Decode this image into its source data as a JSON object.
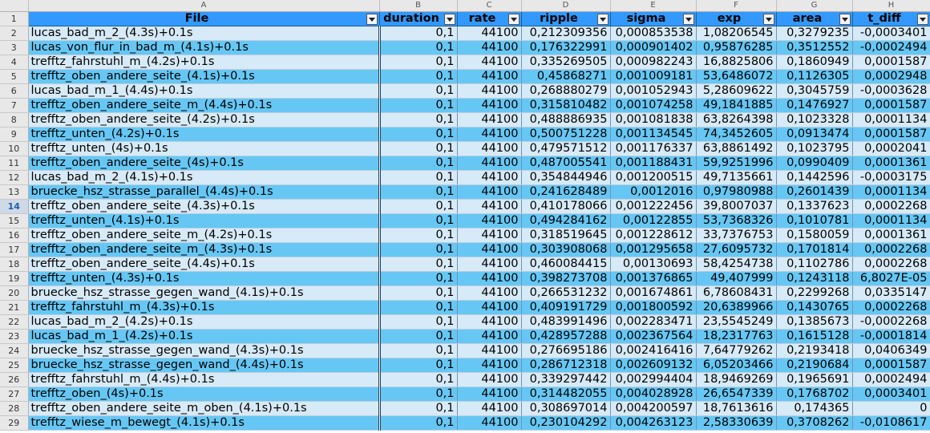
{
  "column_letters": [
    "A",
    "B",
    "C",
    "D",
    "E",
    "F",
    "G",
    "H"
  ],
  "headers": [
    "File",
    "duration",
    "rate",
    "ripple",
    "sigma",
    "exp",
    "area",
    "t_diff"
  ],
  "selected_row": "14",
  "rows": [
    {
      "n": "2",
      "file": "lucas_bad_m_2_(4.3s)+0.1s",
      "duration": "0,1",
      "rate": "44100",
      "ripple": "0,212309356",
      "sigma": "0,000853538",
      "exp": "1,08206545",
      "area": "0,3279235",
      "t_diff": "-0,0003401"
    },
    {
      "n": "3",
      "file": "lucas_von_flur_in_bad_m_(4.1s)+0.1s",
      "duration": "0,1",
      "rate": "44100",
      "ripple": "0,176322991",
      "sigma": "0,000901402",
      "exp": "0,95876285",
      "area": "0,3512552",
      "t_diff": "-0,0002494"
    },
    {
      "n": "4",
      "file": "trefftz_fahrstuhl_m_(4.2s)+0.1s",
      "duration": "0,1",
      "rate": "44100",
      "ripple": "0,335269505",
      "sigma": "0,000982243",
      "exp": "16,8825806",
      "area": "0,1860949",
      "t_diff": "0,0001587"
    },
    {
      "n": "5",
      "file": "trefftz_oben_andere_seite_(4.1s)+0.1s",
      "duration": "0,1",
      "rate": "44100",
      "ripple": "0,45868271",
      "sigma": "0,001009181",
      "exp": "53,6486072",
      "area": "0,1126305",
      "t_diff": "0,0002948"
    },
    {
      "n": "6",
      "file": "lucas_bad_m_1_(4.4s)+0.1s",
      "duration": "0,1",
      "rate": "44100",
      "ripple": "0,268880279",
      "sigma": "0,001052943",
      "exp": "5,28609622",
      "area": "0,3045759",
      "t_diff": "-0,0003628"
    },
    {
      "n": "7",
      "file": "trefftz_oben_andere_seite_m_(4.4s)+0.1s",
      "duration": "0,1",
      "rate": "44100",
      "ripple": "0,315810482",
      "sigma": "0,001074258",
      "exp": "49,1841885",
      "area": "0,1476927",
      "t_diff": "0,0001587"
    },
    {
      "n": "8",
      "file": "trefftz_oben_andere_seite_(4.2s)+0.1s",
      "duration": "0,1",
      "rate": "44100",
      "ripple": "0,488886935",
      "sigma": "0,001081838",
      "exp": "63,8264398",
      "area": "0,1023328",
      "t_diff": "0,0001134"
    },
    {
      "n": "9",
      "file": "trefftz_unten_(4.2s)+0.1s",
      "duration": "0,1",
      "rate": "44100",
      "ripple": "0,500751228",
      "sigma": "0,001134545",
      "exp": "74,3452605",
      "area": "0,0913474",
      "t_diff": "0,0001587"
    },
    {
      "n": "10",
      "file": "trefftz_unten_(4s)+0.1s",
      "duration": "0,1",
      "rate": "44100",
      "ripple": "0,479571512",
      "sigma": "0,001176337",
      "exp": "63,8861492",
      "area": "0,1023795",
      "t_diff": "0,0002041"
    },
    {
      "n": "11",
      "file": "trefftz_oben_andere_seite_(4s)+0.1s",
      "duration": "0,1",
      "rate": "44100",
      "ripple": "0,487005541",
      "sigma": "0,001188431",
      "exp": "59,9251996",
      "area": "0,0990409",
      "t_diff": "0,0001361"
    },
    {
      "n": "12",
      "file": "lucas_bad_m_2_(4.1s)+0.1s",
      "duration": "0,1",
      "rate": "44100",
      "ripple": "0,354844946",
      "sigma": "0,001200515",
      "exp": "49,7135661",
      "area": "0,1442596",
      "t_diff": "-0,0003175"
    },
    {
      "n": "13",
      "file": "bruecke_hsz_strasse_parallel_(4.4s)+0.1s",
      "duration": "0,1",
      "rate": "44100",
      "ripple": "0,241628489",
      "sigma": "0,0012016",
      "exp": "0,97980988",
      "area": "0,2601439",
      "t_diff": "0,0001134"
    },
    {
      "n": "14",
      "file": "trefftz_oben_andere_seite_(4.3s)+0.1s",
      "duration": "0,1",
      "rate": "44100",
      "ripple": "0,410178066",
      "sigma": "0,001222456",
      "exp": "39,8007037",
      "area": "0,1337623",
      "t_diff": "0,0002268"
    },
    {
      "n": "15",
      "file": "trefftz_unten_(4.1s)+0.1s",
      "duration": "0,1",
      "rate": "44100",
      "ripple": "0,494284162",
      "sigma": "0,00122855",
      "exp": "53,7368326",
      "area": "0,1010781",
      "t_diff": "0,0001134"
    },
    {
      "n": "16",
      "file": "trefftz_oben_andere_seite_m_(4.2s)+0.1s",
      "duration": "0,1",
      "rate": "44100",
      "ripple": "0,318519645",
      "sigma": "0,001228612",
      "exp": "33,7376753",
      "area": "0,1580059",
      "t_diff": "0,0001361"
    },
    {
      "n": "17",
      "file": "trefftz_oben_andere_seite_m_(4.3s)+0.1s",
      "duration": "0,1",
      "rate": "44100",
      "ripple": "0,303908068",
      "sigma": "0,001295658",
      "exp": "27,6095732",
      "area": "0,1701814",
      "t_diff": "0,0002268"
    },
    {
      "n": "18",
      "file": "trefftz_oben_andere_seite_(4.4s)+0.1s",
      "duration": "0,1",
      "rate": "44100",
      "ripple": "0,460084415",
      "sigma": "0,00130693",
      "exp": "58,4254738",
      "area": "0,1102786",
      "t_diff": "0,0002268"
    },
    {
      "n": "19",
      "file": "trefftz_unten_(4.3s)+0.1s",
      "duration": "0,1",
      "rate": "44100",
      "ripple": "0,398273708",
      "sigma": "0,001376865",
      "exp": "49,407999",
      "area": "0,1243118",
      "t_diff": "6,8027E-05"
    },
    {
      "n": "20",
      "file": "bruecke_hsz_strasse_gegen_wand_(4.1s)+0.1s",
      "duration": "0,1",
      "rate": "44100",
      "ripple": "0,266531232",
      "sigma": "0,001674861",
      "exp": "6,78608431",
      "area": "0,2299268",
      "t_diff": "0,0335147"
    },
    {
      "n": "21",
      "file": "trefftz_fahrstuhl_m_(4.3s)+0.1s",
      "duration": "0,1",
      "rate": "44100",
      "ripple": "0,409191729",
      "sigma": "0,001800592",
      "exp": "20,6389966",
      "area": "0,1430765",
      "t_diff": "0,0002268"
    },
    {
      "n": "22",
      "file": "lucas_bad_m_2_(4.2s)+0.1s",
      "duration": "0,1",
      "rate": "44100",
      "ripple": "0,483991496",
      "sigma": "0,002283471",
      "exp": "23,5545249",
      "area": "0,1385673",
      "t_diff": "-0,0002268"
    },
    {
      "n": "23",
      "file": "lucas_bad_m_1_(4.2s)+0.1s",
      "duration": "0,1",
      "rate": "44100",
      "ripple": "0,428957288",
      "sigma": "0,002367564",
      "exp": "18,2317763",
      "area": "0,1615128",
      "t_diff": "-0,0001814"
    },
    {
      "n": "24",
      "file": "bruecke_hsz_strasse_gegen_wand_(4.3s)+0.1s",
      "duration": "0,1",
      "rate": "44100",
      "ripple": "0,276695186",
      "sigma": "0,002416416",
      "exp": "7,64779262",
      "area": "0,2193418",
      "t_diff": "0,0406349"
    },
    {
      "n": "25",
      "file": "bruecke_hsz_strasse_gegen_wand_(4.4s)+0.1s",
      "duration": "0,1",
      "rate": "44100",
      "ripple": "0,286712318",
      "sigma": "0,002609132",
      "exp": "6,05203466",
      "area": "0,2190684",
      "t_diff": "0,0001587"
    },
    {
      "n": "26",
      "file": "trefftz_fahrstuhl_m_(4.4s)+0.1s",
      "duration": "0,1",
      "rate": "44100",
      "ripple": "0,339297442",
      "sigma": "0,002994404",
      "exp": "18,9469269",
      "area": "0,1965691",
      "t_diff": "0,0002494"
    },
    {
      "n": "27",
      "file": "trefftz_oben_(4s)+0.1s",
      "duration": "0,1",
      "rate": "44100",
      "ripple": "0,314482055",
      "sigma": "0,004028928",
      "exp": "26,6547339",
      "area": "0,1768702",
      "t_diff": "0,0003401"
    },
    {
      "n": "28",
      "file": "trefftz_oben_andere_seite_m_oben_(4.1s)+0.1s",
      "duration": "0,1",
      "rate": "44100",
      "ripple": "0,308697014",
      "sigma": "0,004200597",
      "exp": "18,7613616",
      "area": "0,174365",
      "t_diff": "0"
    },
    {
      "n": "29",
      "file": "trefftz_wiese_m_bewegt_(4.1s)+0.1s",
      "duration": "0,1",
      "rate": "44100",
      "ripple": "0,230104292",
      "sigma": "0,004263123",
      "exp": "2,58330639",
      "area": "0,3708262",
      "t_diff": "-0,0108617"
    }
  ]
}
